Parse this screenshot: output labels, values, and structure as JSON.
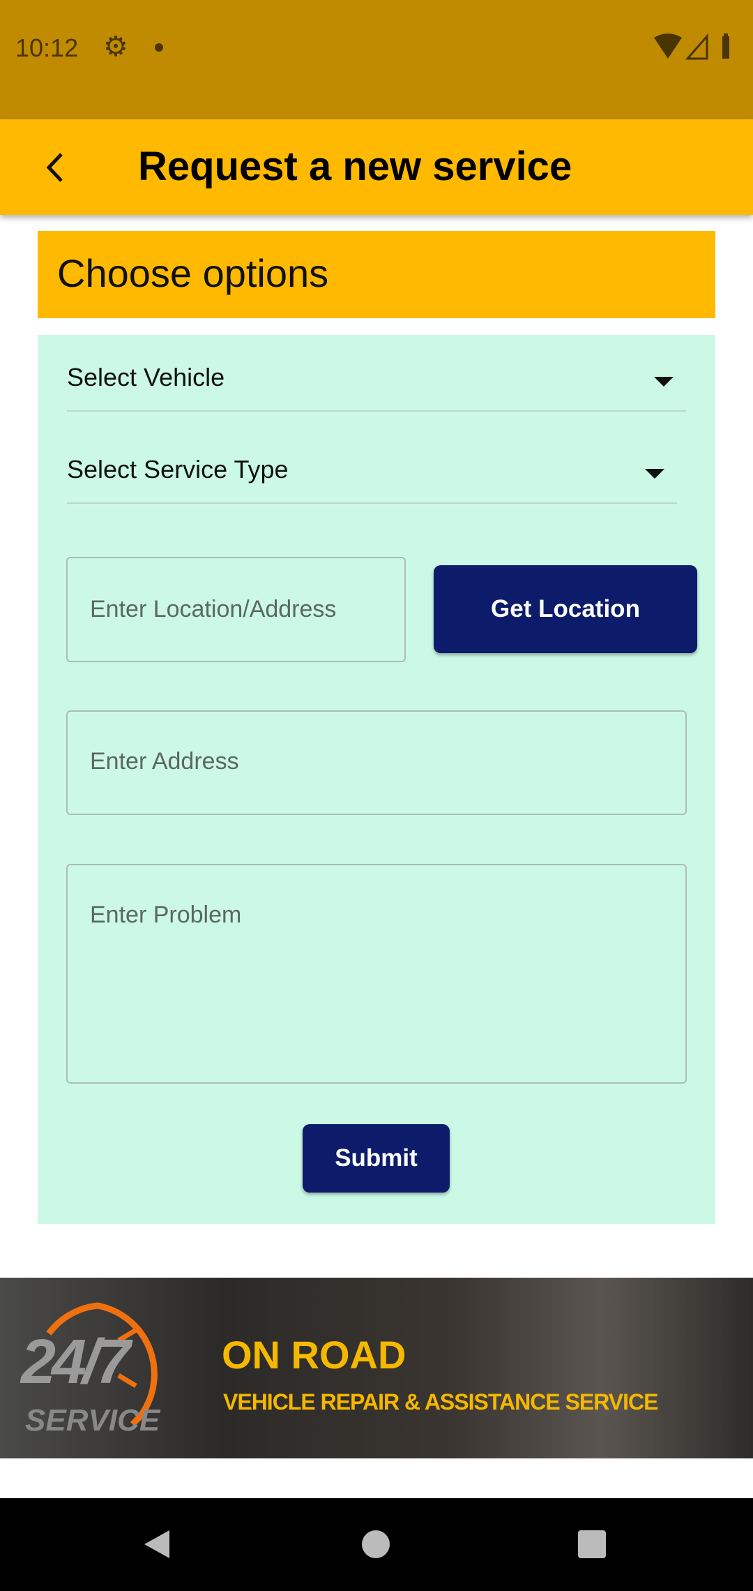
{
  "status_bar": {
    "time": "10:12"
  },
  "app_bar": {
    "title": "Request a new service"
  },
  "section": {
    "title": "Choose options"
  },
  "form": {
    "vehicle_select": "Select Vehicle",
    "service_type_select": "Select Service Type",
    "location_placeholder": "Enter Location/Address",
    "get_location_label": "Get Location",
    "address_placeholder": "Enter Address",
    "problem_placeholder": "Enter Problem",
    "submit_label": "Submit"
  },
  "banner": {
    "badge_number": "24/7",
    "badge_word": "SERVICE",
    "headline": "ON ROAD",
    "tagline": "VEHICLE REPAIR & ASSISTANCE SERVICE"
  },
  "colors": {
    "primary": "#ffb901",
    "button": "#0c1c6b",
    "panel": "#cbf9e6",
    "status": "#c08b00"
  }
}
